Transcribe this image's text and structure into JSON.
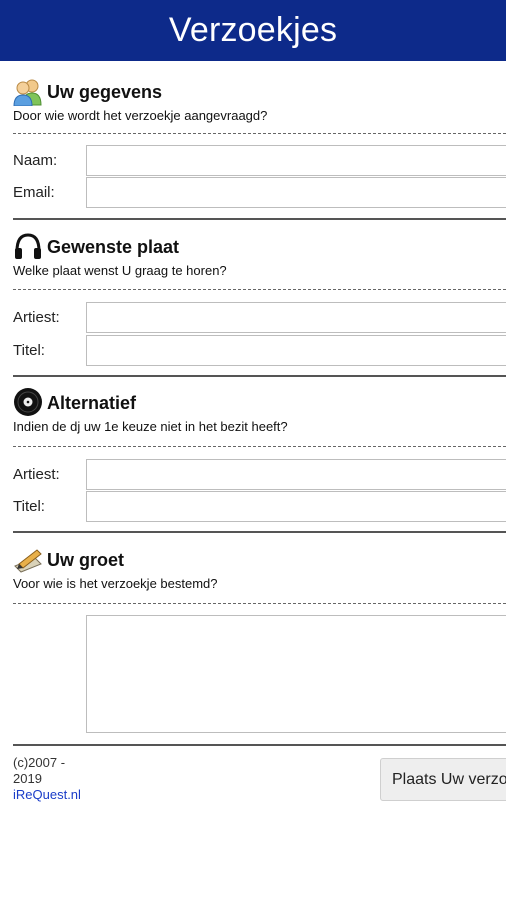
{
  "header": {
    "title": "Verzoekjes"
  },
  "sections": [
    {
      "title": "Uw gegevens",
      "subtitle": "Door wie wordt het verzoekje aangevraagd?",
      "icon": "users-icon",
      "fields": [
        {
          "label": "Naam:",
          "value": ""
        },
        {
          "label": "Email:",
          "value": ""
        }
      ]
    },
    {
      "title": "Gewenste plaat",
      "subtitle": "Welke plaat wenst U graag te horen?",
      "icon": "headphones-icon",
      "fields": [
        {
          "label": "Artiest:",
          "value": ""
        },
        {
          "label": "Titel:",
          "value": ""
        }
      ]
    },
    {
      "title": "Alternatief",
      "subtitle": "Indien de dj uw 1e keuze niet in het bezit heeft?",
      "icon": "vinyl-record-icon",
      "fields": [
        {
          "label": "Artiest:",
          "value": ""
        },
        {
          "label": "Titel:",
          "value": ""
        }
      ]
    },
    {
      "title": "Uw groet",
      "subtitle": "Voor wie is het verzoekje bestemd?",
      "icon": "pen-paper-icon",
      "message": ""
    }
  ],
  "footer": {
    "copyright_line1": "(c)2007 -",
    "copyright_line2": "2019",
    "link": "iReQuest.nl"
  },
  "submit_label": "Plaats Uw verzoekje",
  "colors": {
    "header": "#0d2a8a",
    "link": "#1a3cc8"
  }
}
